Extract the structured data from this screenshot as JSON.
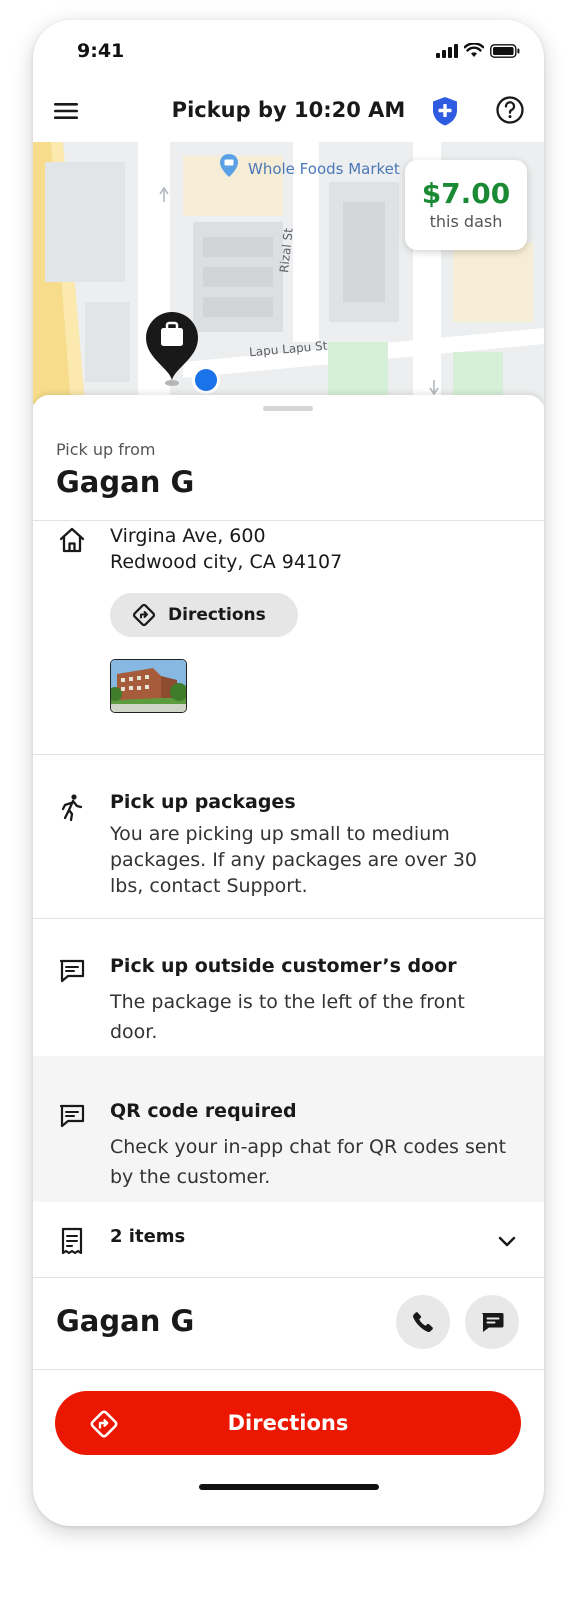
{
  "status_bar": {
    "time": "9:41"
  },
  "header": {
    "title": "Pickup by 10:20 AM"
  },
  "map": {
    "poi": "Whole Foods Market",
    "streets": [
      "Rizal St",
      "Lapu Lapu St"
    ],
    "earnings": {
      "amount": "$7.00",
      "label": "this dash"
    }
  },
  "pickup": {
    "label": "Pick up from",
    "name": "Gagan G"
  },
  "address": {
    "line1": "Virgina Ave, 600",
    "line2": "Redwood city, CA 94107",
    "directions_label": "Directions"
  },
  "instructions": [
    {
      "title": "Pick up packages",
      "text": "You are picking up small to medium packages. If any packages are over 30 lbs, contact Support.",
      "icon": "walking-person-icon"
    },
    {
      "title": "Pick up outside customer’s door",
      "text": "The package is to the left of the front door.",
      "icon": "message-icon"
    },
    {
      "title": "QR code required",
      "text": "Check your in-app chat for QR codes sent by the customer.",
      "icon": "message-icon"
    }
  ],
  "items": {
    "label": "2 items"
  },
  "customer": {
    "name": "Gagan G"
  },
  "cta": {
    "label": "Directions"
  },
  "colors": {
    "accent": "#eb1700",
    "earnings": "#1a8a34",
    "shield": "#2f5be0"
  }
}
